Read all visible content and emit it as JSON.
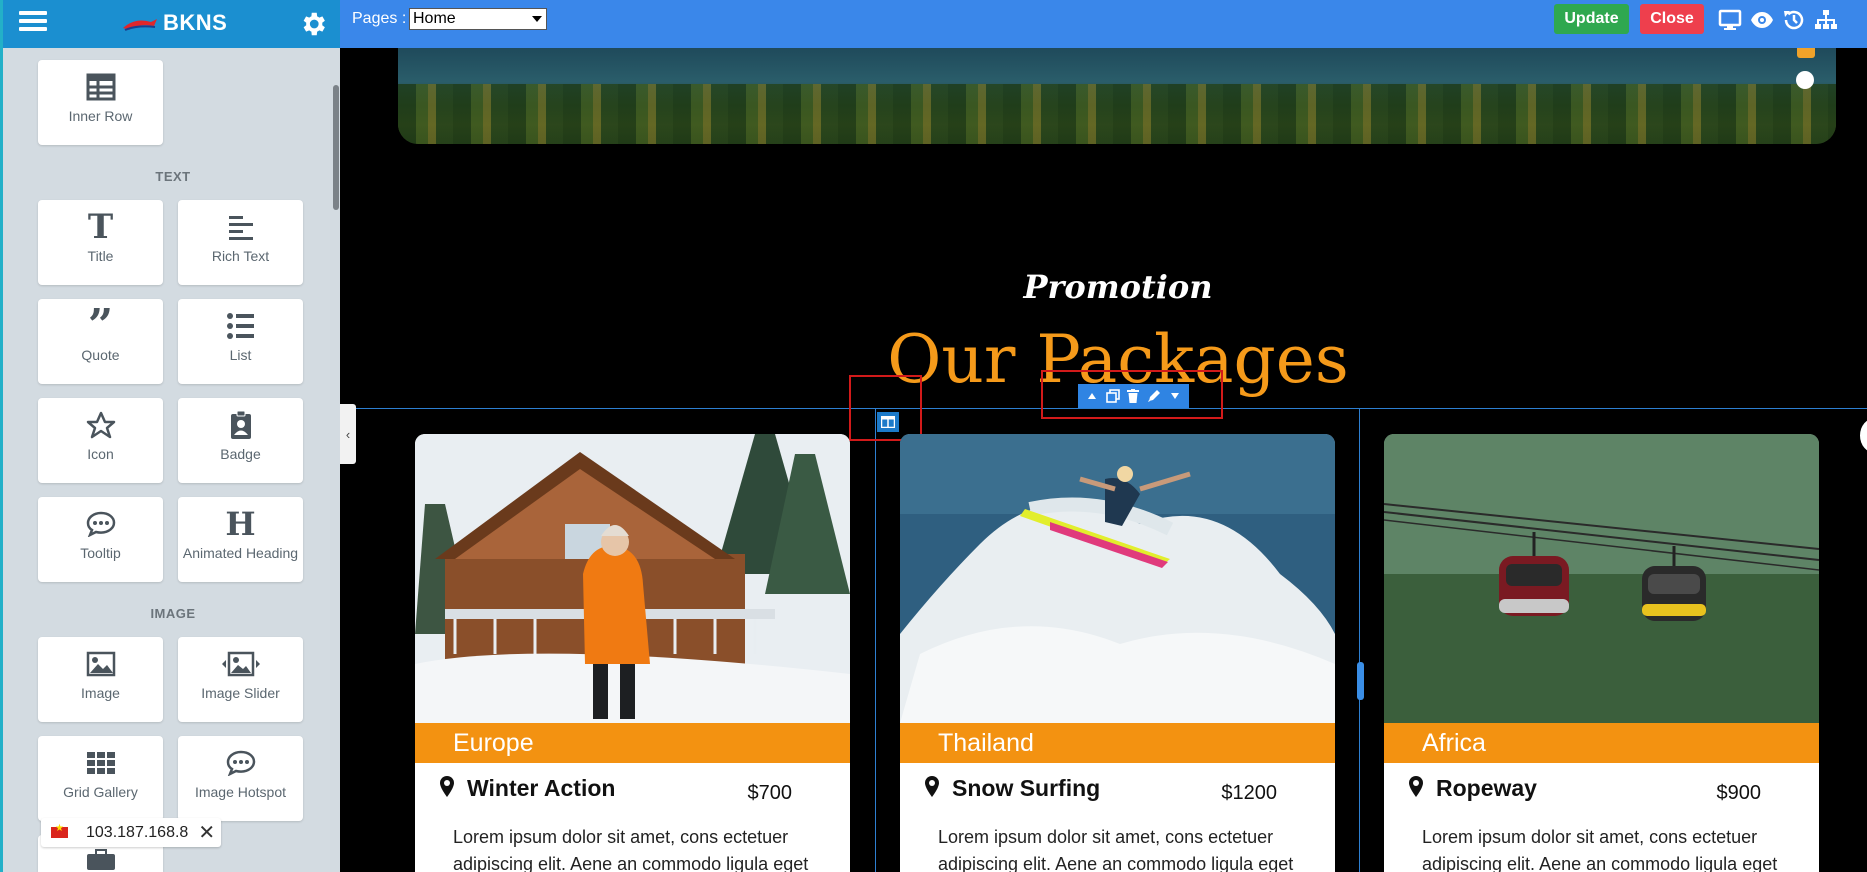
{
  "sidebar": {
    "brand": "BKNS",
    "sections": {
      "text_title": "TEXT",
      "image_title": "IMAGE"
    },
    "tiles": {
      "inner_row": "Inner Row",
      "title": "Title",
      "rich_text": "Rich Text",
      "quote": "Quote",
      "list": "List",
      "icon": "Icon",
      "badge": "Badge",
      "tooltip": "Tooltip",
      "animated_heading": "Animated Heading",
      "image": "Image",
      "image_slider": "Image Slider",
      "grid_gallery": "Grid Gallery",
      "image_hotspot": "Image Hotspot"
    },
    "ip": "103.187.168.8"
  },
  "topbar": {
    "pages_label": "Pages :",
    "pages_selected": "Home",
    "update_label": "Update",
    "close_label": "Close",
    "accent_update": "#2fa84f",
    "accent_close": "#ee3f4d"
  },
  "canvas": {
    "promo": "Promotion",
    "heading": "Our Packages",
    "cards": [
      {
        "region": "Europe",
        "title": "Winter Action",
        "price": "$700",
        "desc": "Lorem ipsum dolor sit amet, cons ectetuer adipiscing elit. Aene an commodo ligula eget"
      },
      {
        "region": "Thailand",
        "title": "Snow Surfing",
        "price": "$1200",
        "desc": "Lorem ipsum dolor sit amet, cons ectetuer adipiscing elit. Aene an commodo ligula eget"
      },
      {
        "region": "Africa",
        "title": "Ropeway",
        "price": "$900",
        "desc": "Lorem ipsum dolor sit amet, cons ectetuer adipiscing elit. Aene an commodo ligula eget"
      }
    ],
    "accent": "#f39211"
  }
}
